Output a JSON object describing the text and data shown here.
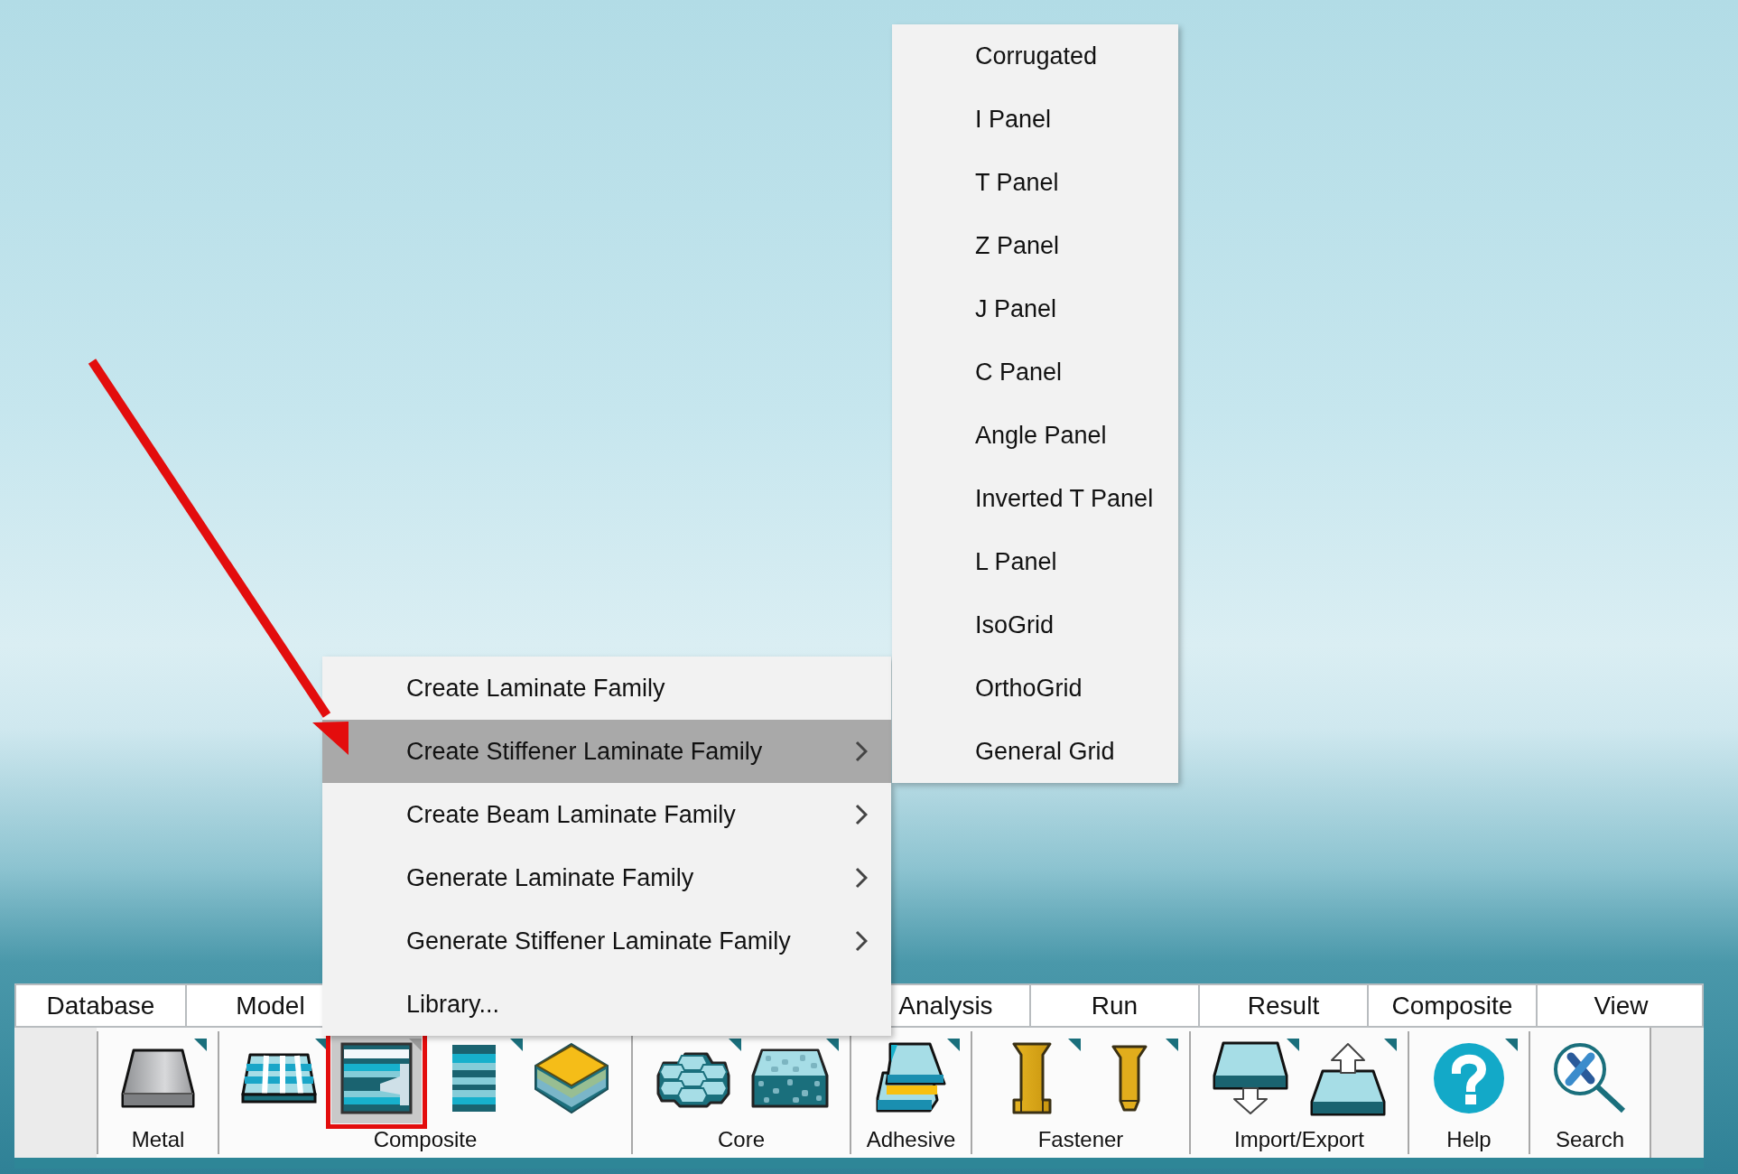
{
  "submenu": {
    "items": [
      {
        "label": "Corrugated",
        "selected": false
      },
      {
        "label": "I Panel",
        "selected": false
      },
      {
        "label": "T Panel",
        "selected": false
      },
      {
        "label": "Z Panel",
        "selected": false
      },
      {
        "label": "J Panel",
        "selected": false
      },
      {
        "label": "C Panel",
        "selected": false
      },
      {
        "label": "Angle Panel",
        "selected": false
      },
      {
        "label": "Inverted T Panel",
        "selected": false
      },
      {
        "label": "L Panel",
        "selected": false
      },
      {
        "label": "IsoGrid",
        "selected": false
      },
      {
        "label": "OrthoGrid",
        "selected": false
      },
      {
        "label": "General Grid",
        "selected": false
      }
    ]
  },
  "context_menu": {
    "items": [
      {
        "label": "Create Laminate Family",
        "selected": false,
        "has_submenu": false
      },
      {
        "label": "Create Stiffener Laminate Family",
        "selected": true,
        "has_submenu": true
      },
      {
        "label": "Create Beam Laminate Family",
        "selected": false,
        "has_submenu": true
      },
      {
        "label": "Generate Laminate Family",
        "selected": false,
        "has_submenu": true
      },
      {
        "label": "Generate Stiffener Laminate Family",
        "selected": false,
        "has_submenu": true
      },
      {
        "label": "Library...",
        "selected": false,
        "has_submenu": false
      }
    ]
  },
  "menu_bar": {
    "tabs": [
      {
        "label": "Database"
      },
      {
        "label": "Model"
      },
      {
        "label": "Analysis"
      },
      {
        "label": "Run"
      },
      {
        "label": "Result"
      },
      {
        "label": "Composite"
      },
      {
        "label": "View"
      }
    ]
  },
  "ribbon": {
    "groups": [
      {
        "label": "Metal",
        "tools": [
          {
            "selected": false,
            "marked": false,
            "has_menu": true
          }
        ]
      },
      {
        "label": "Composite",
        "tools": [
          {
            "selected": false,
            "marked": false,
            "has_menu": true
          },
          {
            "selected": true,
            "marked": true,
            "has_menu": true
          },
          {
            "selected": false,
            "marked": false,
            "has_menu": true
          },
          {
            "selected": false,
            "marked": false,
            "has_menu": false
          }
        ]
      },
      {
        "label": "Core",
        "tools": [
          {
            "selected": false,
            "marked": false,
            "has_menu": true
          },
          {
            "selected": false,
            "marked": false,
            "has_menu": true
          }
        ]
      },
      {
        "label": "Adhesive",
        "tools": [
          {
            "selected": false,
            "marked": false,
            "has_menu": true
          }
        ]
      },
      {
        "label": "Fastener",
        "tools": [
          {
            "selected": false,
            "marked": false,
            "has_menu": true
          },
          {
            "selected": false,
            "marked": false,
            "has_menu": true
          }
        ]
      },
      {
        "label": "Import/Export",
        "tools": [
          {
            "selected": false,
            "marked": false,
            "has_menu": true
          },
          {
            "selected": false,
            "marked": false,
            "has_menu": true
          }
        ]
      },
      {
        "label": "Help",
        "tools": [
          {
            "selected": false,
            "marked": false,
            "has_menu": true
          }
        ]
      },
      {
        "label": "Search",
        "tools": [
          {
            "selected": false,
            "marked": false,
            "has_menu": false
          }
        ]
      }
    ]
  },
  "annotation": {
    "kind": "arrow"
  }
}
